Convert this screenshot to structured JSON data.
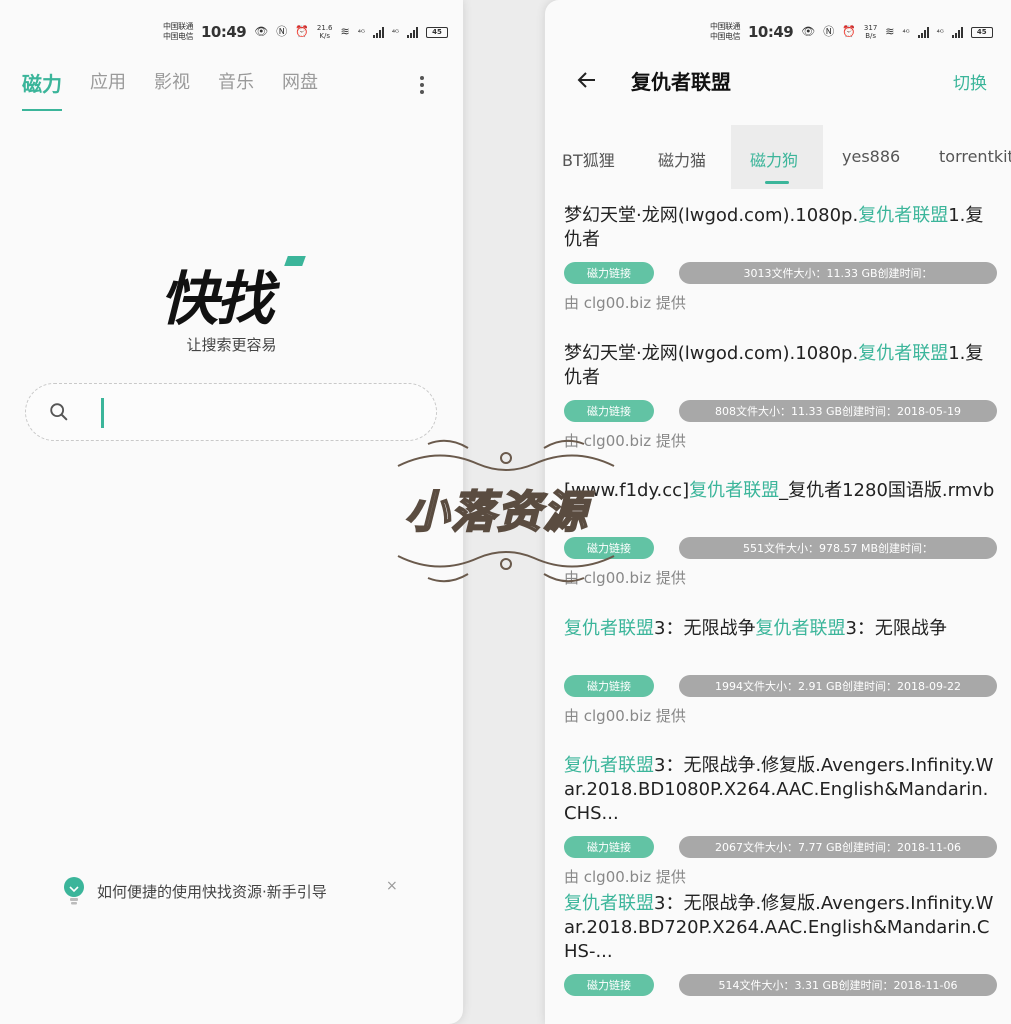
{
  "status_bar": {
    "carrier_1": "中国联通",
    "carrier_2": "中国电信",
    "time": "10:49",
    "left_speed_value": "21.6",
    "left_speed_unit": "K/s",
    "right_speed_value": "317",
    "right_speed_unit": "B/s",
    "battery": "45",
    "network_1": "⁴ᴳ",
    "network_2": "⁴ᴳ"
  },
  "home": {
    "tabs": [
      "磁力",
      "应用",
      "影视",
      "音乐",
      "网盘"
    ],
    "active_tab": 0,
    "logo": "快找",
    "slogan": "让搜索更容易",
    "search": {
      "value": "",
      "placeholder": ""
    },
    "guide_text": "如何便捷的使用快找资源·新手引导",
    "guide_close": "×"
  },
  "results_page": {
    "title": "复仇者联盟",
    "switch_label": "切换",
    "source_tabs": [
      "BT狐狸",
      "磁力猫",
      "磁力狗",
      "yes886",
      "torrentkitty"
    ],
    "active_source": 2,
    "items": [
      {
        "title_parts": [
          {
            "t": "梦幻天堂·龙网(lwgod.com).1080p.",
            "h": false
          },
          {
            "t": "复仇者联盟",
            "h": true
          },
          {
            "t": "1.复仇者",
            "h": false
          }
        ],
        "badge": "磁力链接",
        "meta": "3013文件大小：11.33 GB创建时间：",
        "source": "由 clg00.biz 提供"
      },
      {
        "title_parts": [
          {
            "t": "梦幻天堂·龙网(lwgod.com).1080p.",
            "h": false
          },
          {
            "t": "复仇者联盟",
            "h": true
          },
          {
            "t": "1.复仇者",
            "h": false
          }
        ],
        "badge": "磁力链接",
        "meta": "808文件大小：11.33 GB创建时间：2018-05-19",
        "source": "由 clg00.biz 提供"
      },
      {
        "title_parts": [
          {
            "t": "[www.f1dy.cc]",
            "h": false
          },
          {
            "t": "复仇者联盟",
            "h": true
          },
          {
            "t": "_复仇者1280国语版.rmvb",
            "h": false
          }
        ],
        "badge": "磁力链接",
        "meta": "551文件大小：978.57 MB创建时间：",
        "source": "由 clg00.biz 提供"
      },
      {
        "title_parts": [
          {
            "t": "复仇者联盟",
            "h": true
          },
          {
            "t": "3：无限战争",
            "h": false
          },
          {
            "t": "复仇者联盟",
            "h": true
          },
          {
            "t": "3：无限战争",
            "h": false
          }
        ],
        "badge": "磁力链接",
        "meta": "1994文件大小：2.91 GB创建时间：2018-09-22",
        "source": "由 clg00.biz 提供"
      },
      {
        "title_parts": [
          {
            "t": "复仇者联盟",
            "h": true
          },
          {
            "t": "3：无限战争.修复版.Avengers.Infinity.War.2018.BD1080P.X264.AAC.English&Mandarin.CHS...",
            "h": false
          }
        ],
        "badge": "磁力链接",
        "meta": "2067文件大小：7.77 GB创建时间：2018-11-06",
        "source": "由 clg00.biz 提供"
      },
      {
        "title_parts": [
          {
            "t": "复仇者联盟",
            "h": true
          },
          {
            "t": "3：无限战争.修复版.Avengers.Infinity.War.2018.BD720P.X264.AAC.English&Mandarin.CHS-...",
            "h": false
          }
        ],
        "badge": "磁力链接",
        "meta": "514文件大小：3.31 GB创建时间：2018-11-06",
        "source": ""
      }
    ]
  },
  "watermark": "小落资源",
  "colors": {
    "accent": "#3bb59a",
    "badge": "#62c3a4",
    "meta_pill": "#a8a8a8"
  }
}
